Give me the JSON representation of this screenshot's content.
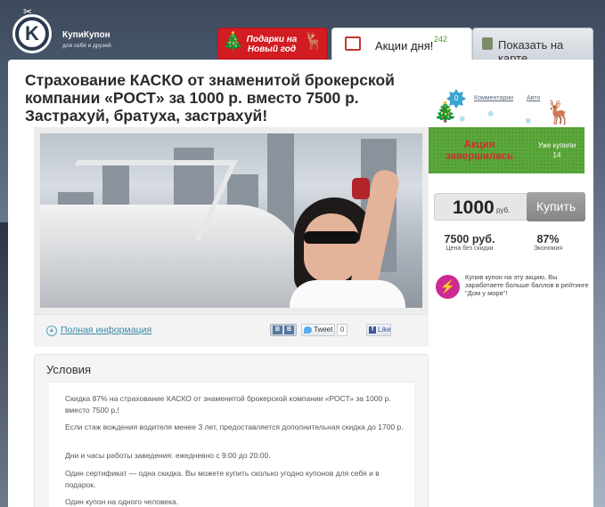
{
  "site": {
    "logo_name": "КупиКупон",
    "logo_sub": "для себя и друзей"
  },
  "tabs": {
    "holiday": "Подарки на Новый год",
    "deals_label": "Акции дня!",
    "deals_count": "242",
    "map_label": "Показать на карте"
  },
  "offer": {
    "title": "Страхование КАСКО от знаменитой брокерской компании «РОСТ» за 1000 р. вместо 7500 р. Застрахуй, братуха, застрахуй!",
    "full_info_link": "Полная информация"
  },
  "social": {
    "vk_b1": "В",
    "vk_b2": "В",
    "tweet_label": "Tweet",
    "tweet_count": "0",
    "fb_icon": "f",
    "fb_label": "Like"
  },
  "conditions": {
    "title": "Условия",
    "paragraphs": [
      "Скидка 87% на страхование КАСКО от знаменитой брокерской компании «РОСТ» за 1000 р. вместо 7500 р.!",
      "Если стаж вождения водителя менее 3 лет, предоставляется дополнительная скидка до 1700 р.",
      "Дни и часы работы заведения: ежедневно с 9:00 до 20:00.",
      "Один сертификат — одна скидка. Вы можете купить сколько угодно купонов для себя и в подарок.",
      "Один купон на одного человека."
    ]
  },
  "sidebar": {
    "comments_count": "0",
    "comments_link": "Комментарии",
    "auto_link": "Авто",
    "status": "Акция завершилась",
    "bought_label": "Уже купили",
    "bought_count": "14",
    "price": "1000",
    "currency": "руб.",
    "buy_button": "Купить",
    "original_price": "7500 руб.",
    "original_price_label": "Цена без скидки",
    "discount": "87%",
    "discount_label": "Экономия",
    "promo_text": "Купив купон на эту акцию, Вы заработаете больше баллов в рейтинге \"Дом у моря\"!"
  },
  "colors": {
    "holiday_red": "#d21c22",
    "green_band": "#5aa83a",
    "status_red": "#d22c2c",
    "link_blue": "#3a87a8",
    "promo_pink": "#ce2a95"
  },
  "icons": {
    "logo": "scissors-coupon-logo",
    "deals": "calendar-icon",
    "map": "map-pin-icon",
    "info": "info-circle-icon",
    "promo": "lightning-icon"
  }
}
